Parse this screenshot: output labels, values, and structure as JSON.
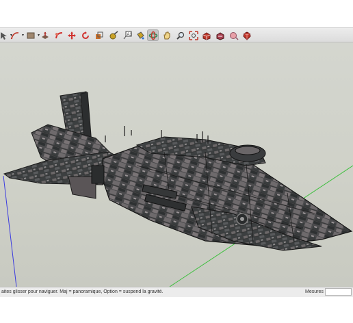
{
  "toolbar": {
    "tools": [
      {
        "name": "select-arrow-icon",
        "color": "#555555"
      },
      {
        "name": "arc-pencil-icon",
        "color": "#c0392b"
      },
      {
        "name": "rectangle-icon",
        "color": "#7a6a5a"
      },
      {
        "name": "push-pull-icon",
        "color": "#b0302a"
      },
      {
        "name": "follow-me-icon",
        "color": "#d0312d"
      },
      {
        "name": "move-icon",
        "color": "#d0312d"
      },
      {
        "name": "rotate-icon",
        "color": "#d0312d"
      },
      {
        "name": "scale-icon",
        "color": "#c96f2a"
      },
      {
        "name": "tape-measure-icon",
        "color": "#c9a227"
      },
      {
        "name": "text-label-icon",
        "color": "#444444"
      },
      {
        "name": "paint-bucket-icon",
        "color": "#c9a227"
      },
      {
        "name": "orbit-icon",
        "color": "#2e8b57"
      },
      {
        "name": "pan-hand-icon",
        "color": "#d8b04a"
      },
      {
        "name": "zoom-icon",
        "color": "#444444"
      },
      {
        "name": "zoom-extents-icon",
        "color": "#c0392b"
      },
      {
        "name": "warehouse-icon",
        "color": "#c0392b"
      },
      {
        "name": "extension-warehouse-icon",
        "color": "#c06070"
      },
      {
        "name": "ruby-icon",
        "color": "#c0392b"
      }
    ]
  },
  "statusbar": {
    "hint": "aites glisser pour naviguer. Maj = panoramique, Option =  suspend la gravité.",
    "measurements_label": "Mesures",
    "measurements_value": ""
  },
  "viewport": {
    "background": "#cfd1c8",
    "axis_colors": {
      "green": "#3fbf3f",
      "blue": "#3a3ae0"
    }
  }
}
